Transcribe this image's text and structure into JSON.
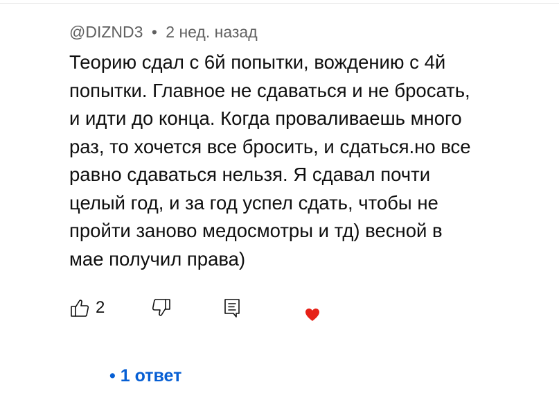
{
  "comment": {
    "author": "@DIZND3",
    "separator": "•",
    "time": "2 нед. назад",
    "text": "Теорию сдал с 6й попытки, вождению с 4й\nпопытки. Главное не сдаваться и не бросать,\nи идти до конца. Когда проваливаешь много\nраз, то хочется все бросить, и сдаться.но все\nравно сдаваться нельзя. Я сдавал почти\nцелый год, и за год успел сдать, чтобы не\nпройти заново медосмотры и тд) весной в\nмае получил права)",
    "like_count": "2"
  },
  "actions": {
    "like_icon": "thumbs-up-icon",
    "dislike_icon": "thumbs-down-icon",
    "reply_icon": "reply-comment-icon",
    "heart_icon": "creator-heart-icon",
    "heart_color": "#e62117"
  },
  "replies": {
    "bullet": "•",
    "label": "1 ответ",
    "color": "#065fd4"
  }
}
